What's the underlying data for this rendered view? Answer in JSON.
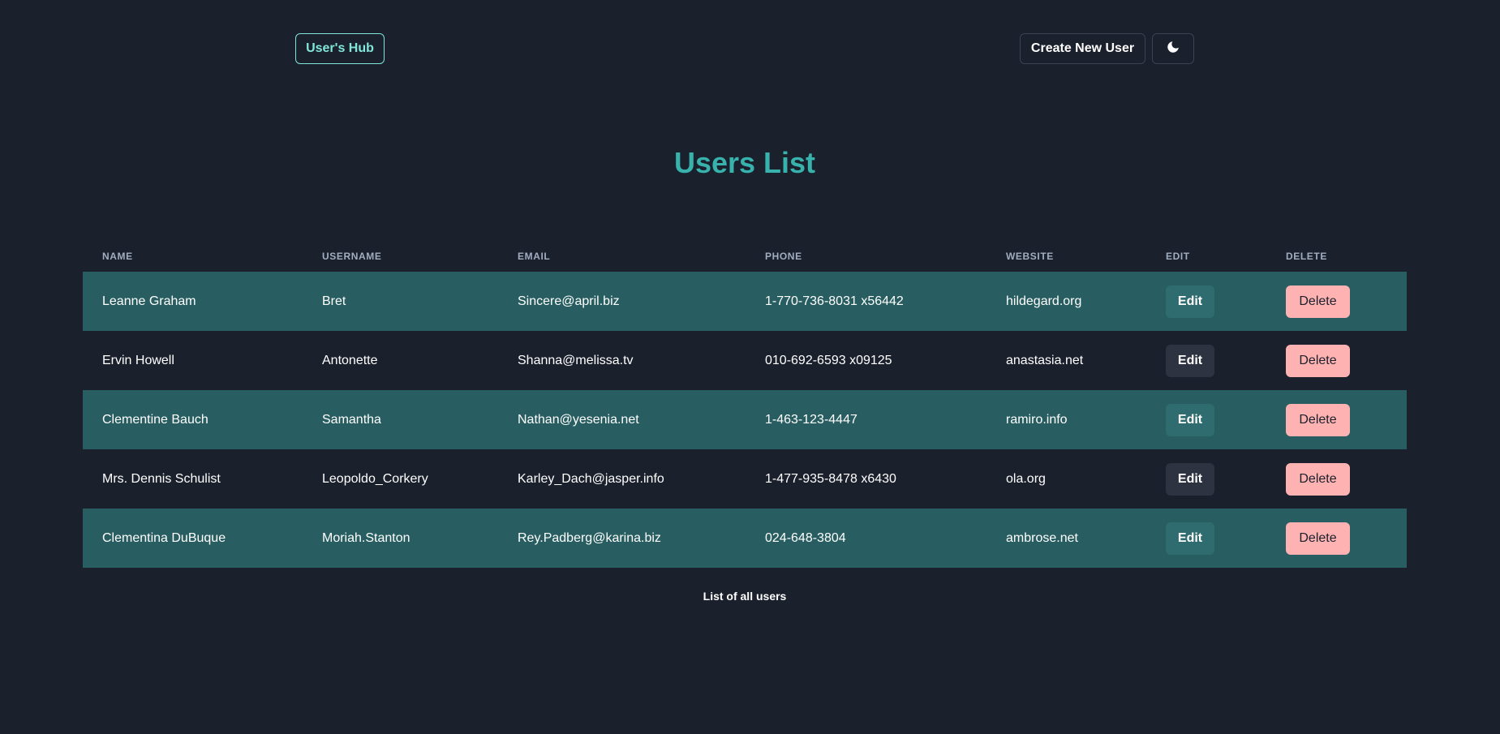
{
  "header": {
    "brand_label": "User's Hub",
    "create_label": "Create New User",
    "theme_icon": "moon-icon"
  },
  "page_title": "Users List",
  "table": {
    "columns": [
      "Name",
      "Username",
      "Email",
      "Phone",
      "Website",
      "Edit",
      "Delete"
    ],
    "rows": [
      {
        "name": "Leanne Graham",
        "username": "Bret",
        "email": "Sincere@april.biz",
        "phone": "1-770-736-8031 x56442",
        "website": "hildegard.org",
        "edit_label": "Edit",
        "delete_label": "Delete"
      },
      {
        "name": "Ervin Howell",
        "username": "Antonette",
        "email": "Shanna@melissa.tv",
        "phone": "010-692-6593 x09125",
        "website": "anastasia.net",
        "edit_label": "Edit",
        "delete_label": "Delete"
      },
      {
        "name": "Clementine Bauch",
        "username": "Samantha",
        "email": "Nathan@yesenia.net",
        "phone": "1-463-123-4447",
        "website": "ramiro.info",
        "edit_label": "Edit",
        "delete_label": "Delete"
      },
      {
        "name": "Mrs. Dennis Schulist",
        "username": "Leopoldo_Corkery",
        "email": "Karley_Dach@jasper.info",
        "phone": "1-477-935-8478 x6430",
        "website": "ola.org",
        "edit_label": "Edit",
        "delete_label": "Delete"
      },
      {
        "name": "Clementina DuBuque",
        "username": "Moriah.Stanton",
        "email": "Rey.Padberg@karina.biz",
        "phone": "024-648-3804",
        "website": "ambrose.net",
        "edit_label": "Edit",
        "delete_label": "Delete"
      }
    ],
    "caption": "List of all users"
  },
  "colors": {
    "background": "#1a202c",
    "accent": "#38b2ac",
    "brand_border": "#81e6d9",
    "stripe": "#285e61",
    "delete": "#feb2b2"
  }
}
